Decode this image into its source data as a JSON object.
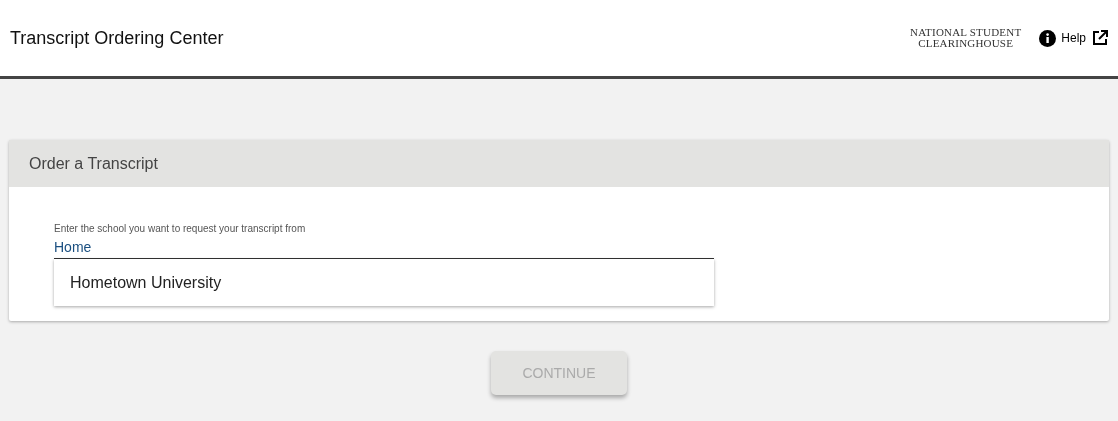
{
  "header": {
    "title": "Transcript Ordering Center",
    "logo_lines": [
      "NATIONAL STUDENT",
      "CLEARINGHOUSE"
    ],
    "help": "Help"
  },
  "card": {
    "title": "Order a Transcript",
    "field": {
      "label": "Enter the school you want to request your transcript from",
      "value": "Home"
    },
    "suggestions": [
      "Hometown University"
    ]
  },
  "continue_button": {
    "label": "CONTINUE",
    "disabled": true
  }
}
